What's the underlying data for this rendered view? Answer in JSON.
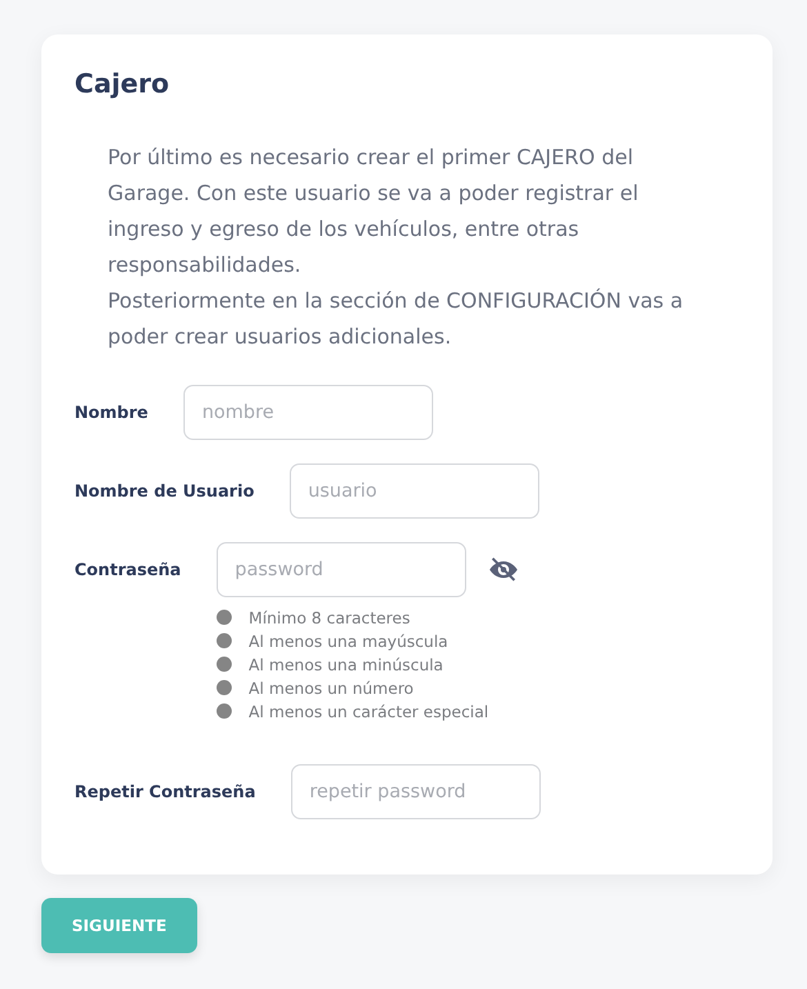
{
  "card": {
    "title": "Cajero",
    "paragraphs": [
      "Por último es necesario crear el primer CAJERO del Garage. Con este usuario se va a poder registrar el ingreso y egreso de los vehículos, entre otras responsabilidades.",
      "Posteriormente en la sección de CONFIGURACIÓN vas a poder crear usuarios adicionales."
    ],
    "fields": [
      {
        "kind": "text",
        "label": "Nombre",
        "placeholder": "nombre"
      },
      {
        "kind": "text",
        "label": "Nombre de Usuario",
        "placeholder": "usuario"
      },
      {
        "kind": "password",
        "label": "Contraseña",
        "placeholder": "password",
        "requirements": [
          {
            "text": "Mínimo 8 caracteres",
            "met": false
          },
          {
            "text": "Al menos una mayúscula",
            "met": false
          },
          {
            "text": "Al menos una minúscula",
            "met": false
          },
          {
            "text": "Al menos un número",
            "met": false
          },
          {
            "text": "Al menos un carácter especial",
            "met": false
          }
        ]
      },
      {
        "kind": "repeat",
        "label": "Repetir Contraseña",
        "placeholder": "repetir password"
      }
    ]
  },
  "next_button": "SIGUIENTE"
}
